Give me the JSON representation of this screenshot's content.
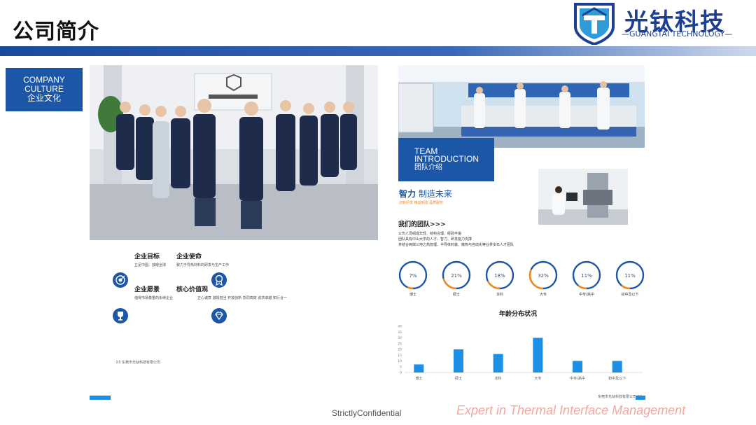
{
  "header": {
    "title": "公司简介",
    "logo_cn": "光钛科技",
    "logo_en": "—GUANGTAI TECHNOLOGY—"
  },
  "colors": {
    "brand_blue": "#1c56a6",
    "accent_orange": "#f08a24",
    "bar_blue": "#1c8fe6"
  },
  "culture": {
    "en_line1": "COMPANY",
    "en_line2": "CULTURE",
    "cn": "企业文化"
  },
  "goals": [
    {
      "title": "企业目标",
      "desc": "立足中国、放眼全球",
      "icon": "target-icon"
    },
    {
      "title": "企业使命",
      "desc": "致力于导热材料的研发与生产工作",
      "icon": ""
    },
    {
      "title": "企业愿景",
      "desc": "值得市场尊重的永续企业",
      "icon": "trophy-icon"
    },
    {
      "title": "核心价值观",
      "desc": "正心诚意 激情担当 开放创新 协同高效 追求卓越 知行合一",
      "icon": "medal-icon"
    }
  ],
  "extra_icons": [
    "award-icon",
    "diamond-icon"
  ],
  "left_footer": {
    "page": "03",
    "company": "东莞市光钛科技有限公司"
  },
  "team_box": {
    "en_line1": "TEAM",
    "en_line2": "INTRODUCTION",
    "cn": "团队介绍"
  },
  "smart": {
    "bold": "智力",
    "rest": "制造未来",
    "sub": "创新研发 精益制造 品质服务"
  },
  "our_team": {
    "title": "我们的团队>>>",
    "lines": [
      "公司人员组成年轻、结构合理、经验丰富",
      "团队具有中山大学的人才、智力、研发能力支撑",
      "并结合两岸三地之热管理、半导体封装、散热与自动化等业界多年人才团队"
    ]
  },
  "education": [
    {
      "percent": "7%",
      "value": 7,
      "label": "博士"
    },
    {
      "percent": "21%",
      "value": 21,
      "label": "硕士"
    },
    {
      "percent": "18%",
      "value": 18,
      "label": "本科"
    },
    {
      "percent": "32%",
      "value": 32,
      "label": "大专"
    },
    {
      "percent": "11%",
      "value": 11,
      "label": "中专/高中"
    },
    {
      "percent": "11%",
      "value": 11,
      "label": "初中及以下"
    }
  ],
  "chart_data": {
    "type": "bar",
    "title": "年龄分布状况",
    "categories": [
      "博士",
      "硕士",
      "本科",
      "大专",
      "中专/高中",
      "初中及以下"
    ],
    "values": [
      7,
      20,
      16,
      30,
      10,
      10
    ],
    "ylim": [
      0,
      40
    ],
    "yticks": [
      0,
      5,
      10,
      15,
      20,
      25,
      30,
      35,
      40
    ],
    "xlabel": "",
    "ylabel": "",
    "grid": false
  },
  "right_footer": {
    "company": "东莞市光钛科技有限公司",
    "page": "04"
  },
  "footer": {
    "confidential": "StrictlyConfidential",
    "slogan": "Expert in Thermal Interface Management"
  }
}
